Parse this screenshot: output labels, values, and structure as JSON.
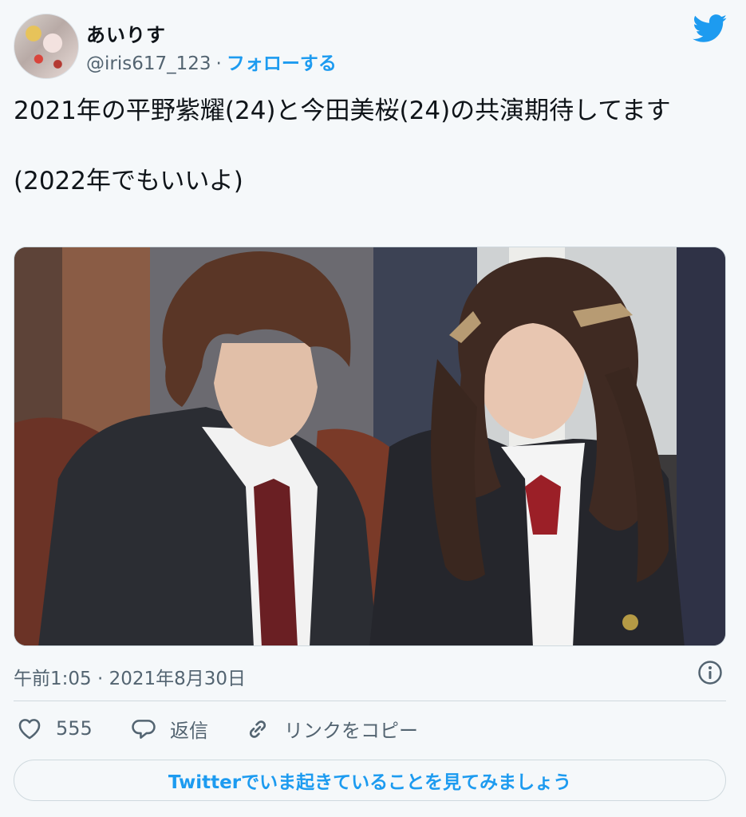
{
  "author": {
    "display_name": "あいりす",
    "handle": "@iris617_123",
    "separator": "·",
    "follow_label": "フォローする"
  },
  "tweet": {
    "text": "2021年の平野紫耀(24)と今田美桜(24)の共演期待してます\n\n(2022年でもいいよ)",
    "timestamp": "午前1:05 · 2021年8月30日"
  },
  "actions": {
    "like_count": "555",
    "reply_label": "返信",
    "copy_link_label": "リンクをコピー"
  },
  "cta_label": "Twitterでいま起きていることを見てみましょう",
  "icons": [
    "twitter-bird-icon",
    "info-icon",
    "heart-icon",
    "reply-bubble-icon",
    "link-icon"
  ],
  "colors": {
    "accent": "#1d9bf0",
    "secondary_text": "#536471",
    "background": "#f5f8fa",
    "border": "#cfd9de"
  }
}
